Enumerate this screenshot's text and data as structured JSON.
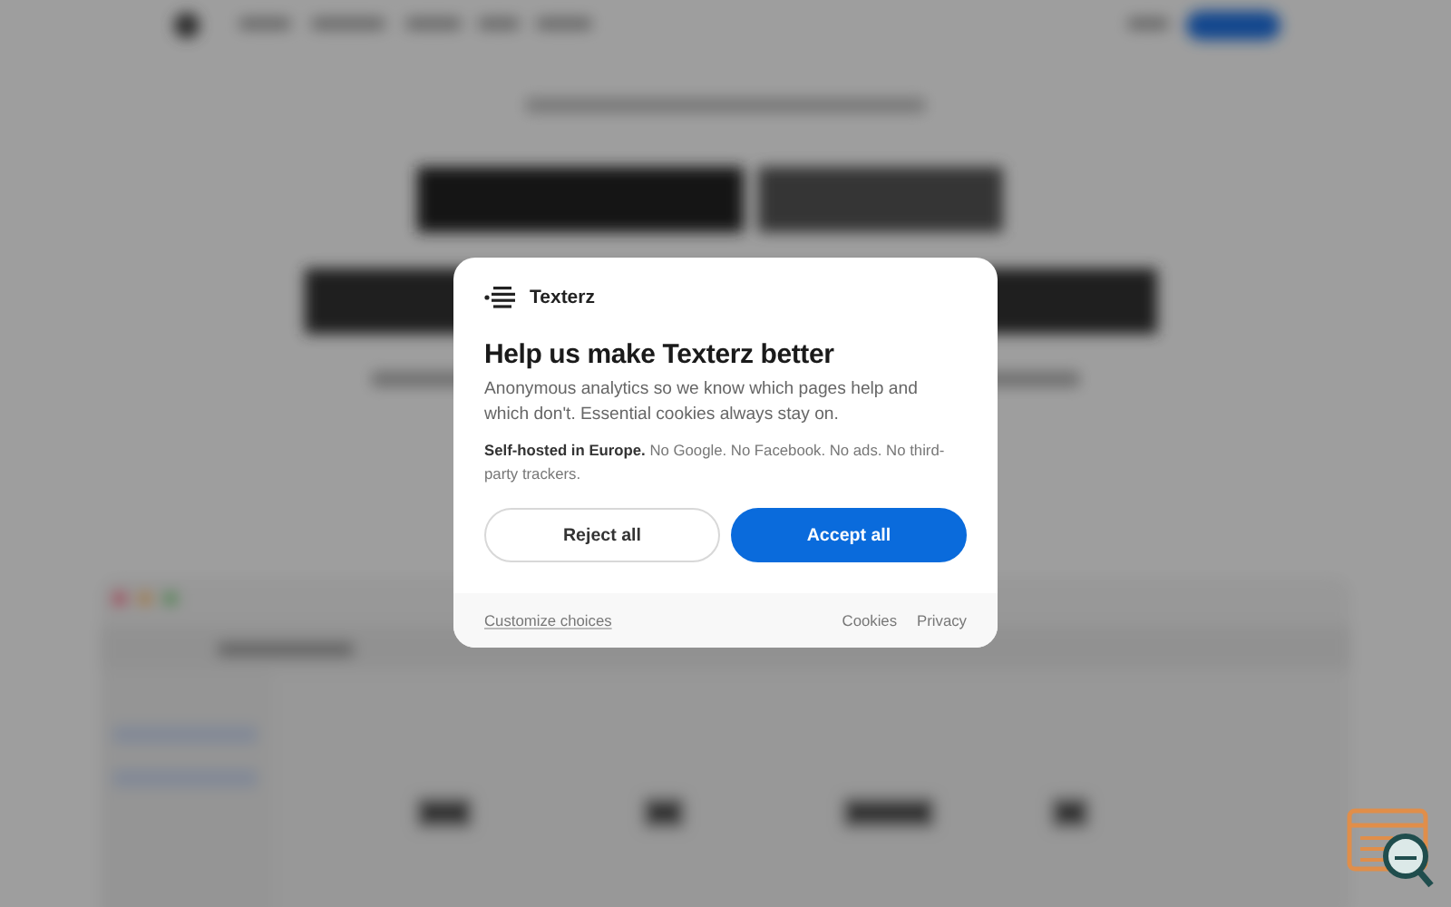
{
  "dialog": {
    "brand": "Texterz",
    "title": "Help us make Texterz better",
    "description": "Anonymous analytics so we know which pages help and which don't. Essential cookies always stay on.",
    "note": "**Self-hosted in Europe.** No Google. No Facebook. No ads. No third-party trackers.",
    "buttons": [
      {
        "label": "Reject all",
        "kind": "secondary"
      },
      {
        "label": "Accept all",
        "kind": "primary"
      }
    ],
    "footer": {
      "customize": "Customize choices",
      "links": [
        "Cookies",
        "Privacy"
      ]
    }
  }
}
